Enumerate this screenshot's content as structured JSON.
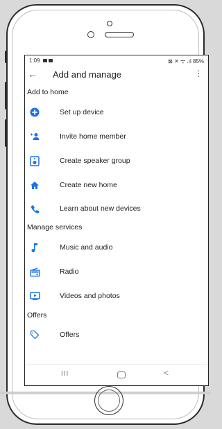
{
  "status": {
    "time": "1:09",
    "right_icons": "⊠ ✕ ᯤ .ıl 85%"
  },
  "appbar": {
    "title": "Add and manage"
  },
  "sections": {
    "add_to_home": "Add to home",
    "manage_services": "Manage services",
    "offers": "Offers"
  },
  "add_to_home_items": [
    {
      "label": "Set up device",
      "icon": "add-circle-icon"
    },
    {
      "label": "Invite home member",
      "icon": "person-add-icon"
    },
    {
      "label": "Create speaker group",
      "icon": "speaker-icon"
    },
    {
      "label": "Create new home",
      "icon": "home-icon"
    },
    {
      "label": "Learn about new devices",
      "icon": "phone-icon"
    }
  ],
  "manage_services_items": [
    {
      "label": "Music and audio",
      "icon": "music-note-icon"
    },
    {
      "label": "Radio",
      "icon": "radio-icon"
    },
    {
      "label": "Videos and photos",
      "icon": "video-icon"
    }
  ],
  "offers_items": [
    {
      "label": "Offers",
      "icon": "tag-icon"
    }
  ],
  "nav": {
    "recent": "III",
    "back": "<"
  },
  "colors": {
    "accent": "#1a73e8"
  }
}
